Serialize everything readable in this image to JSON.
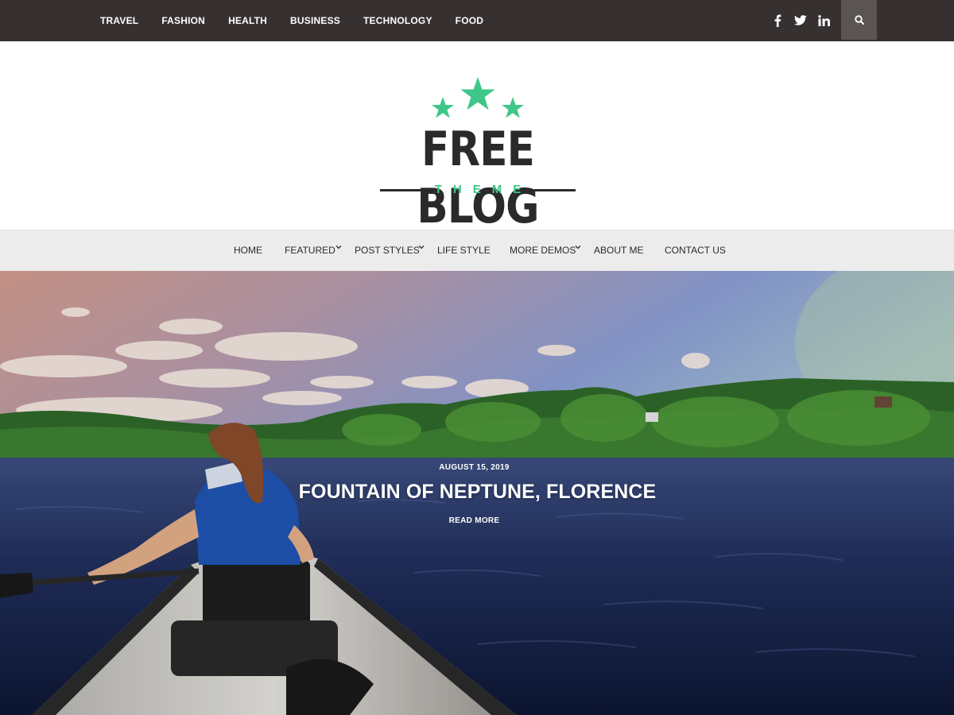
{
  "topbar": {
    "categories": [
      "TRAVEL",
      "FASHION",
      "HEALTH",
      "BUSINESS",
      "TECHNOLOGY",
      "FOOD"
    ],
    "social": [
      "facebook-icon",
      "twitter-icon",
      "linkedin-icon"
    ],
    "search_icon": "search-icon",
    "background_color": "#363130"
  },
  "logo": {
    "title": "FREE BLOG",
    "subtitle": "THEME",
    "accent_color": "#3ec788"
  },
  "nav": {
    "items": [
      {
        "label": "HOME",
        "has_dropdown": false
      },
      {
        "label": "FEATURED",
        "has_dropdown": true
      },
      {
        "label": "POST STYLES",
        "has_dropdown": true
      },
      {
        "label": "LIFE STYLE",
        "has_dropdown": false
      },
      {
        "label": "MORE DEMOS",
        "has_dropdown": true
      },
      {
        "label": "ABOUT ME",
        "has_dropdown": false
      },
      {
        "label": "CONTACT US",
        "has_dropdown": false
      }
    ]
  },
  "hero": {
    "date": "AUGUST 15, 2019",
    "title": "FOUNTAIN OF NEPTUNE, FLORENCE",
    "read_more": "READ MORE"
  }
}
